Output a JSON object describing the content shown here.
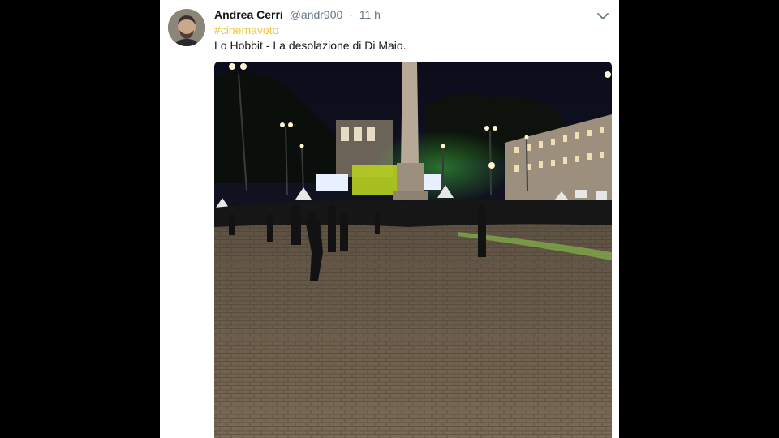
{
  "tweet": {
    "author": {
      "display_name": "Andrea Cerri",
      "handle": "@andr900"
    },
    "separator": "·",
    "timestamp": "11 h",
    "hashtag": "#cinemavoto",
    "text": "Lo Hobbit - La desolazione di Di Maio."
  },
  "icons": {
    "caret": "chevron-down-icon"
  },
  "colors": {
    "hashtag": "#f3c63b",
    "name": "#14171a",
    "secondary": "#657786",
    "backdrop": "#000000"
  }
}
